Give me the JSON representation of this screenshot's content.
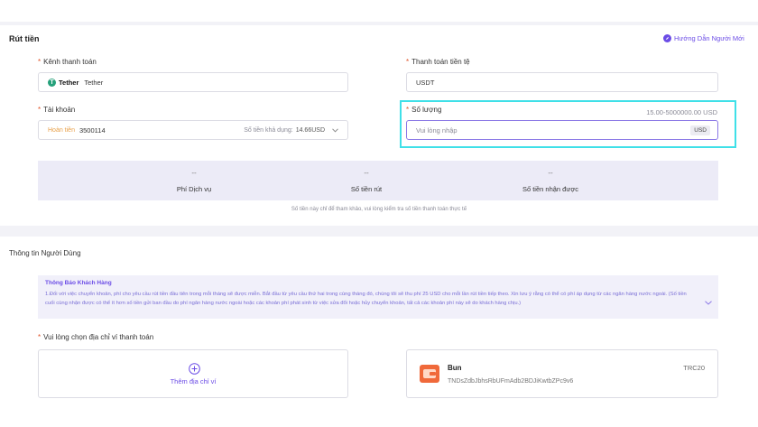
{
  "header": {
    "title": "Rút tiền",
    "guide_label": "Hướng Dẫn Người Mới"
  },
  "channel": {
    "label": "Kênh thanh toán",
    "logo_text": "Tether",
    "value": "Tether"
  },
  "currency": {
    "label": "Thanh toán tiền tệ",
    "value": "USDT"
  },
  "account": {
    "label": "Tài khoản",
    "tag": "Hoàn tiền",
    "number": "3500114",
    "balance_label": "Số tiền khả dụng:",
    "balance_value": "14.66USD"
  },
  "amount": {
    "label": "Số lượng",
    "range": "15.00-5000000.00 USD",
    "placeholder": "Vui lòng nhập",
    "unit": "USD"
  },
  "summary": {
    "items": [
      {
        "value": "--",
        "label": "Phí Dịch vụ"
      },
      {
        "value": "--",
        "label": "Số tiền rút"
      },
      {
        "value": "--",
        "label": "Số tiền nhận được"
      }
    ],
    "note": "Số tiền này chỉ để tham khảo, vui lòng kiểm tra số tiền thanh toán thực tế"
  },
  "user_info": {
    "title": "Thông tin Người Dùng",
    "notice_title": "Thông Báo Khách Hàng",
    "notice_text": "1.Đối với việc chuyển khoản, phí cho yêu cầu rút tiền đầu tiên trong mỗi tháng sẽ được miễn. Bắt đầu từ yêu cầu thứ hai trong cùng tháng đó, chúng tôi sẽ thu phí 25 USD cho mỗi lần rút tiền tiếp theo. Xin lưu ý rằng có thể có phí áp dụng từ các ngân hàng nước ngoài. (Số tiền cuối cùng nhận được có thể ít hơn số tiền gửi ban đầu do phí ngân hàng nước ngoài hoặc các khoản phí phát sinh từ việc sửa đổi hoặc hủy chuyển khoản, tất cả các khoản phí này sẽ do khách hàng chịu.)",
    "wallet_label": "Vui lòng chọn địa chỉ ví thanh toán",
    "add_wallet": "Thêm địa chỉ ví",
    "wallet": {
      "name": "Bun",
      "network": "TRC20",
      "address": "TNDsZdbJbhsRbUFmAdb2BDJiKwtbZPc9v6"
    }
  },
  "colors": {
    "accent": "#6b4ce6",
    "highlight": "#3fe0e8",
    "tether": "#26a17b",
    "wallet_icon": "#f0693a",
    "tag": "#e8a04a"
  },
  "icons": {
    "guide": "compass-icon",
    "tether": "tether-icon",
    "dropdown": "chevron-down-icon",
    "add": "plus-circle-icon",
    "wallet": "wallet-icon"
  }
}
